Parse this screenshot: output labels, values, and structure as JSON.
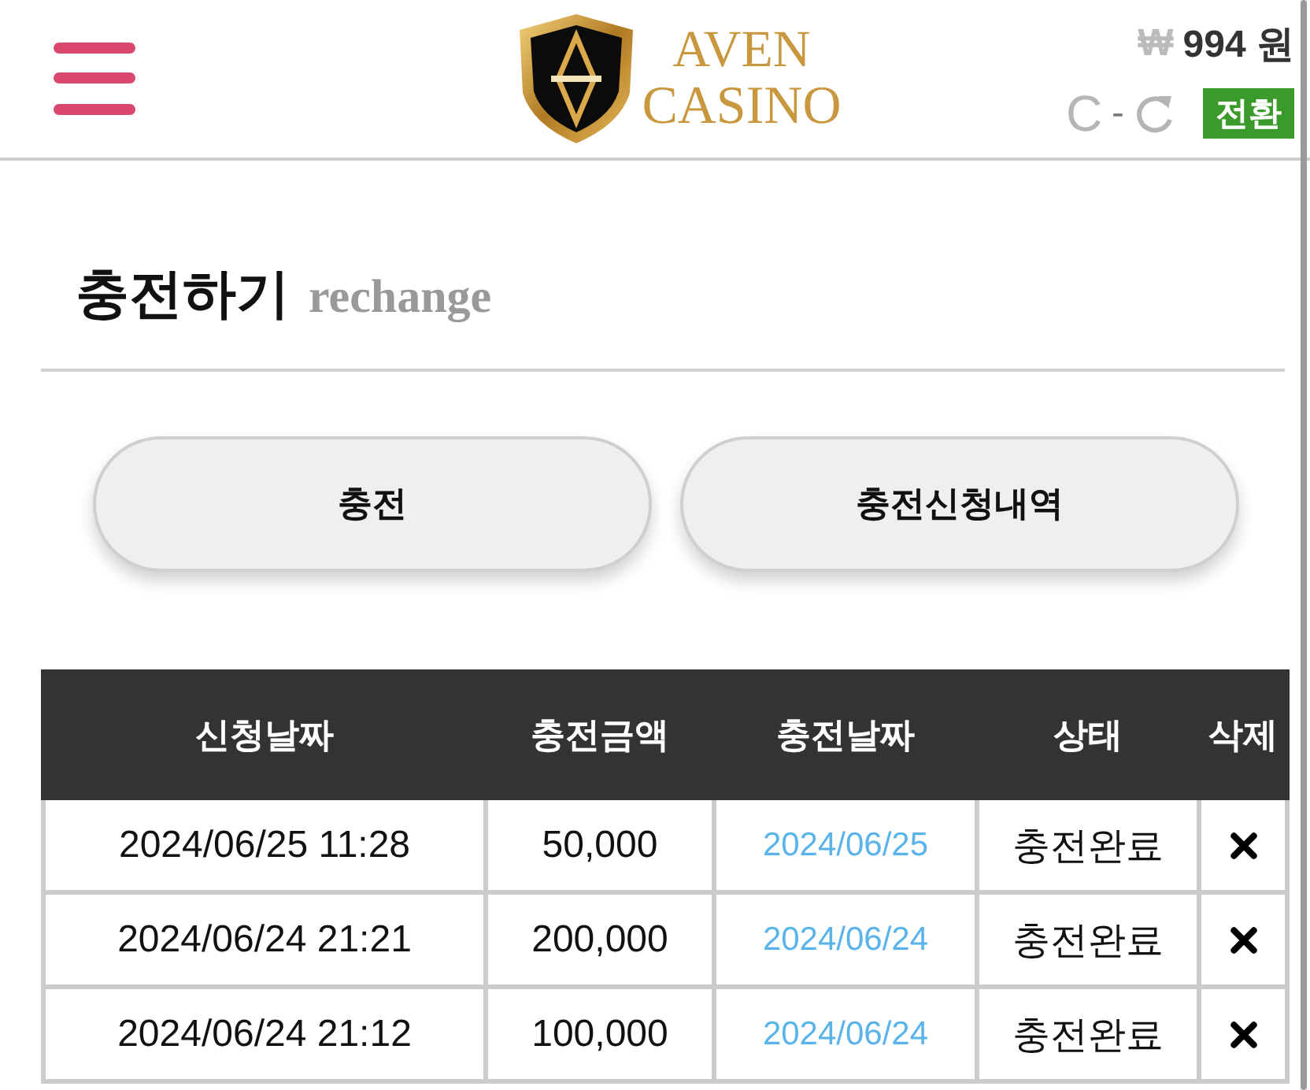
{
  "header": {
    "logo": {
      "line_1": "AVEN",
      "line_2": "CASINO"
    },
    "balance": {
      "currency": "₩",
      "amount": "994 원"
    },
    "conversion": {
      "from": "C",
      "separator": "-"
    },
    "switch_button": "전환"
  },
  "page_title": {
    "title": "충전하기",
    "subtitle": "rechange"
  },
  "buttons": [
    "충전",
    "충전신청내역"
  ],
  "table": {
    "columns": [
      "신청날짜",
      "충전금액",
      "충전날짜",
      "상태",
      "삭제"
    ],
    "rows": [
      {
        "requested_at": "2024/06/25 11:28",
        "amount": "50,000",
        "charged_on": "2024/06/25",
        "status": "충전완료"
      },
      {
        "requested_at": "2024/06/24 21:21",
        "amount": "200,000",
        "charged_on": "2024/06/24",
        "status": "충전완료"
      },
      {
        "requested_at": "2024/06/24 21:12",
        "amount": "100,000",
        "charged_on": "2024/06/24",
        "status": "충전완료"
      }
    ]
  }
}
